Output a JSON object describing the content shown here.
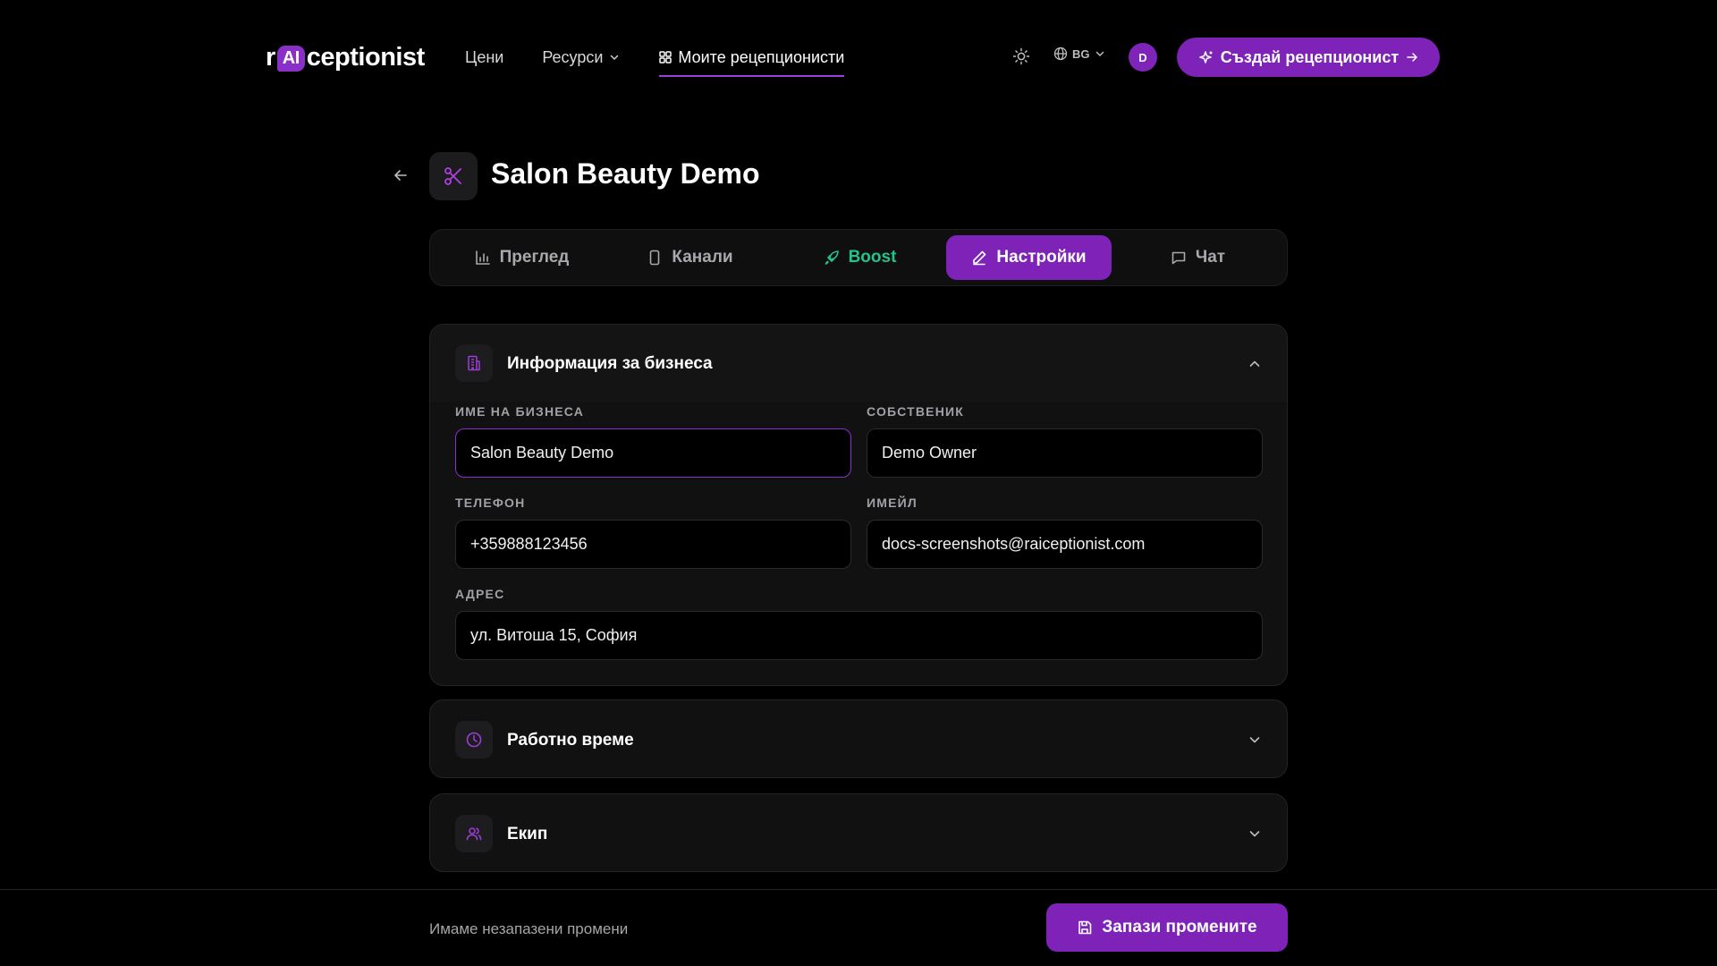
{
  "header": {
    "logo": {
      "prefix": "r",
      "ai": "AI",
      "suffix": "ceptionist"
    },
    "nav": [
      {
        "label": "Цени"
      },
      {
        "label": "Ресурси"
      },
      {
        "label": "Моите рецепционисти"
      }
    ],
    "language": "BG",
    "avatar_initial": "D",
    "create_button": "Създай рецепционист"
  },
  "page": {
    "title": "Salon Beauty Demo"
  },
  "tabs": [
    {
      "label": "Преглед"
    },
    {
      "label": "Канали"
    },
    {
      "label": "Boost"
    },
    {
      "label": "Настройки"
    },
    {
      "label": "Чат"
    }
  ],
  "sections": {
    "business": {
      "title": "Информация за бизнеса",
      "fields": {
        "name": {
          "label": "ИМЕ НА БИЗНЕСА",
          "value": "Salon Beauty Demo"
        },
        "owner": {
          "label": "СОБСТВЕНИК",
          "value": "Demo Owner"
        },
        "phone": {
          "label": "ТЕЛЕФОН",
          "value": "+359888123456"
        },
        "email": {
          "label": "ИМЕЙЛ",
          "value": "docs-screenshots@raiceptionist.com"
        },
        "address": {
          "label": "АДРЕС",
          "value": "ул. Витоша 15, София"
        }
      }
    },
    "hours": {
      "title": "Работно време"
    },
    "team": {
      "title": "Екип"
    }
  },
  "footer": {
    "unsaved_text": "Имаме незапазени промени",
    "save_button": "Запази промените"
  },
  "colors": {
    "accent": "#7e22b8",
    "boost": "#22c38e",
    "background": "#000000"
  }
}
